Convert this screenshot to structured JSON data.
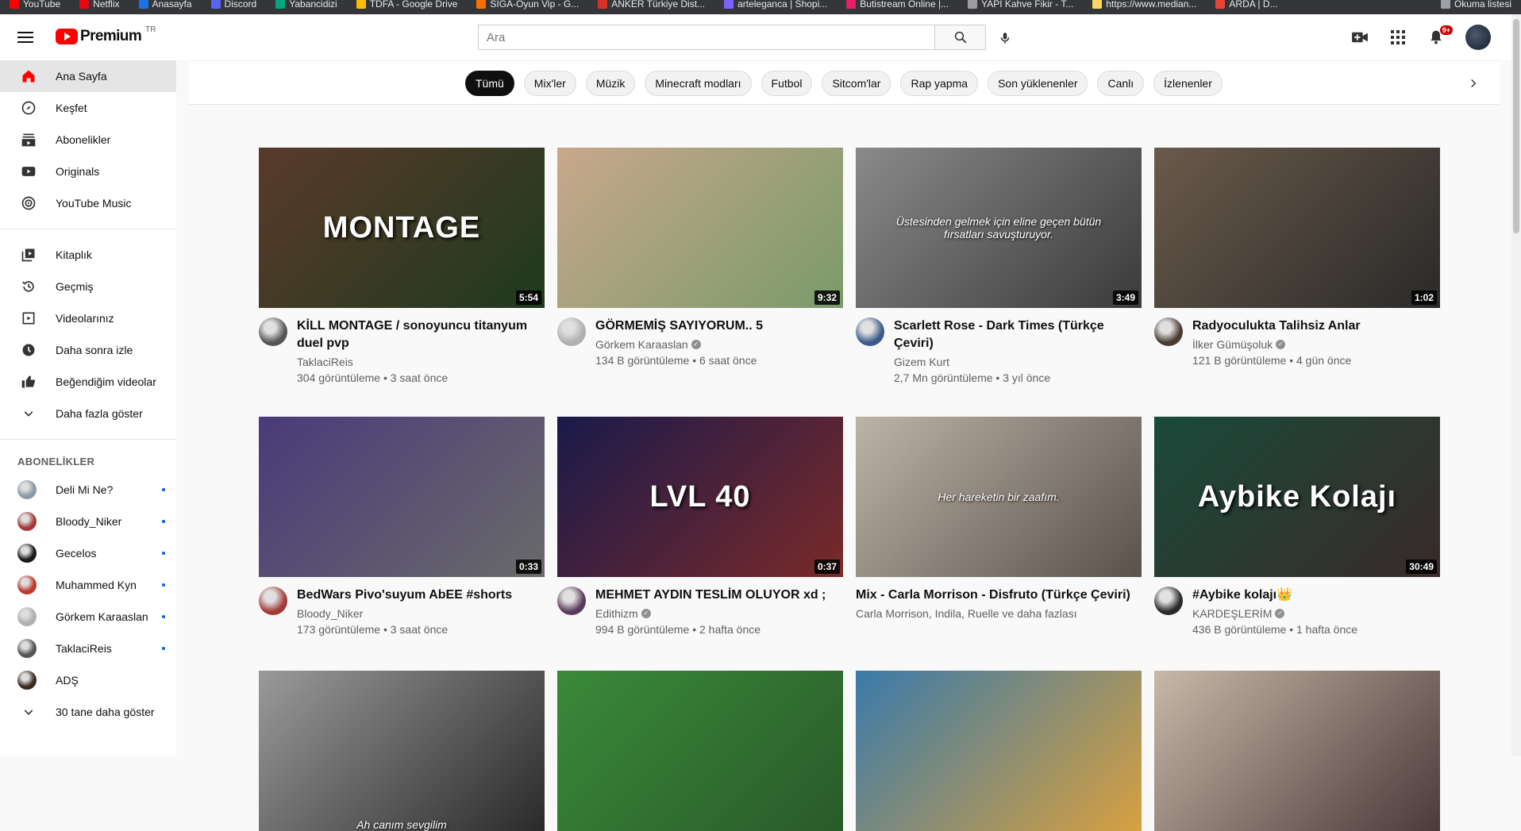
{
  "bookmarks": [
    {
      "label": "YouTube",
      "color": "#ff0000"
    },
    {
      "label": "Netflix",
      "color": "#e50914"
    },
    {
      "label": "Anasayfa",
      "color": "#1a73e8"
    },
    {
      "label": "Discord",
      "color": "#5865f2"
    },
    {
      "label": "Yabancidizi",
      "color": "#00a67e"
    },
    {
      "label": "TDFA - Google Drive",
      "color": "#fbbc04"
    },
    {
      "label": "SIGA-Oyun Vip - G...",
      "color": "#ff6d00"
    },
    {
      "label": "ANKER Türkiye Dist...",
      "color": "#d93025"
    },
    {
      "label": "arteleganca | Shopi...",
      "color": "#7b61ff"
    },
    {
      "label": "Butistream Online |...",
      "color": "#e91e63"
    },
    {
      "label": "YAPI Kahve Fikir - T...",
      "color": "#9e9e9e"
    },
    {
      "label": "https://www.median...",
      "color": "#fdd663"
    },
    {
      "label": "ARDA | D...",
      "color": "#ea4335"
    }
  ],
  "bookmarks_right": "Okuma listesi",
  "header": {
    "logo_text": "Premium",
    "country": "TR",
    "search_placeholder": "Ara",
    "notification_count": "9+"
  },
  "sidebar": {
    "main": [
      {
        "label": "Ana Sayfa",
        "icon": "home-icon",
        "active": true
      },
      {
        "label": "Keşfet",
        "icon": "compass-icon"
      },
      {
        "label": "Abonelikler",
        "icon": "subscriptions-icon"
      },
      {
        "label": "Originals",
        "icon": "originals-icon"
      },
      {
        "label": "YouTube Music",
        "icon": "music-icon"
      }
    ],
    "library": [
      {
        "label": "Kitaplık",
        "icon": "library-icon"
      },
      {
        "label": "Geçmiş",
        "icon": "history-icon"
      },
      {
        "label": "Videolarınız",
        "icon": "your-videos-icon"
      },
      {
        "label": "Daha sonra izle",
        "icon": "watch-later-icon"
      },
      {
        "label": "Beğendiğim videolar",
        "icon": "liked-icon"
      },
      {
        "label": "Daha fazla göster",
        "icon": "chevron-down-icon"
      }
    ],
    "subscriptions_title": "ABONELİKLER",
    "subscriptions": [
      {
        "label": "Deli Mi Ne?",
        "color": "#8a9ba8"
      },
      {
        "label": "Bloody_Niker",
        "color": "#a33a3a"
      },
      {
        "label": "Gecelos",
        "color": "#1a1a1a"
      },
      {
        "label": "Muhammed Kyn",
        "color": "#c0392b"
      },
      {
        "label": "Görkem Karaaslan",
        "color": "#b0b0b0"
      },
      {
        "label": "TaklaciReis",
        "color": "#555555"
      },
      {
        "label": "ADŞ",
        "color": "#3b2a20"
      }
    ],
    "show_more_subs": "30 tane daha göster"
  },
  "chips": [
    "Tümü",
    "Mix'ler",
    "Müzik",
    "Minecraft modları",
    "Futbol",
    "Sitcom'lar",
    "Rap yapma",
    "Son yüklenenler",
    "Canlı",
    "İzlenenler"
  ],
  "videos": [
    {
      "title": "KİLL MONTAGE / sonoyuncu titanyum duel pvp",
      "channel": "TaklaciReis",
      "verified": false,
      "stats": "304 görüntüleme • 3 saat önce",
      "duration": "5:54",
      "art_text": "MONTAGE",
      "thumb": "#5a3a2a",
      "thumb2": "#1e3a1e",
      "avatar": "#555555"
    },
    {
      "title": "GÖRMEMİŞ SAYIYORUM.. 5",
      "channel": "Görkem Karaaslan",
      "verified": true,
      "stats": "134 B görüntüleme • 6 saat önce",
      "duration": "9:32",
      "art_text": "",
      "thumb": "#c8a88a",
      "thumb2": "#7a9a6a",
      "avatar": "#b0b0b0"
    },
    {
      "title": "Scarlett Rose - Dark Times (Türkçe Çeviri)",
      "channel": "Gizem Kurt",
      "verified": false,
      "stats": "2,7 Mn görüntüleme • 3 yıl önce",
      "duration": "3:49",
      "art_text": "Üstesinden gelmek için eline geçen bütün fırsatları savuşturuyor.",
      "thumb": "#8a8a8a",
      "thumb2": "#3a3a3a",
      "avatar": "#3b5a8a"
    },
    {
      "title": "Radyoculukta Talihsiz Anlar",
      "channel": "İlker Gümüşoluk",
      "verified": true,
      "stats": "121 B görüntüleme • 4 gün önce",
      "duration": "1:02",
      "art_text": "",
      "thumb": "#6a5a4a",
      "thumb2": "#2a2a2a",
      "avatar": "#4a3a30"
    },
    {
      "title": "BedWars Pivo'suyum AbEE #shorts",
      "channel": "Bloody_Niker",
      "verified": false,
      "stats": "173 görüntüleme • 3 saat önce",
      "duration": "0:33",
      "art_text": "",
      "thumb": "#4a3a7a",
      "thumb2": "#6a6a6a",
      "avatar": "#a33a3a"
    },
    {
      "title": "MEHMET AYDIN TESLİM OLUYOR xd ;",
      "channel": "Edithizm",
      "verified": true,
      "stats": "994 B görüntüleme • 2 hafta önce",
      "duration": "0:37",
      "art_text": "LVL 40",
      "thumb": "#1a1a4a",
      "thumb2": "#7a2a2a",
      "avatar": "#5a3a5a"
    },
    {
      "title": "Mix - Carla Morrison - Disfruto (Türkçe Çeviri)",
      "channel": "Carla Morrison, Indila, Ruelle ve daha fazlası",
      "verified": false,
      "stats": "",
      "duration": "",
      "art_text": "Her hareketin bir zaafım.",
      "thumb": "#bcb4a8",
      "thumb2": "#5a524a",
      "avatar": ""
    },
    {
      "title": "#Aybike kolajı👑",
      "channel": "KARDEŞLERİM",
      "verified": true,
      "stats": "436 B görüntüleme • 1 hafta önce",
      "duration": "30:49",
      "art_text": "Aybike Kolajı",
      "thumb": "#1a4a3a",
      "thumb2": "#3a2a2a",
      "avatar": "#2a2a2a"
    },
    {
      "title": "",
      "channel": "",
      "verified": false,
      "stats": "",
      "duration": "",
      "art_text": "Ah canım sevgilim",
      "thumb": "#9a9a9a",
      "thumb2": "#2a2a2a",
      "avatar": ""
    },
    {
      "title": "",
      "channel": "",
      "verified": false,
      "stats": "",
      "duration": "",
      "art_text": "",
      "thumb": "#3a8a3a",
      "thumb2": "#2a5a2a",
      "avatar": ""
    },
    {
      "title": "",
      "channel": "",
      "verified": false,
      "stats": "",
      "duration": "",
      "art_text": "",
      "thumb": "#3a7aaa",
      "thumb2": "#d8a040",
      "avatar": ""
    },
    {
      "title": "",
      "channel": "",
      "verified": false,
      "stats": "",
      "duration": "",
      "art_text": "",
      "thumb": "#c8b8a8",
      "thumb2": "#4a3a3a",
      "avatar": ""
    }
  ]
}
